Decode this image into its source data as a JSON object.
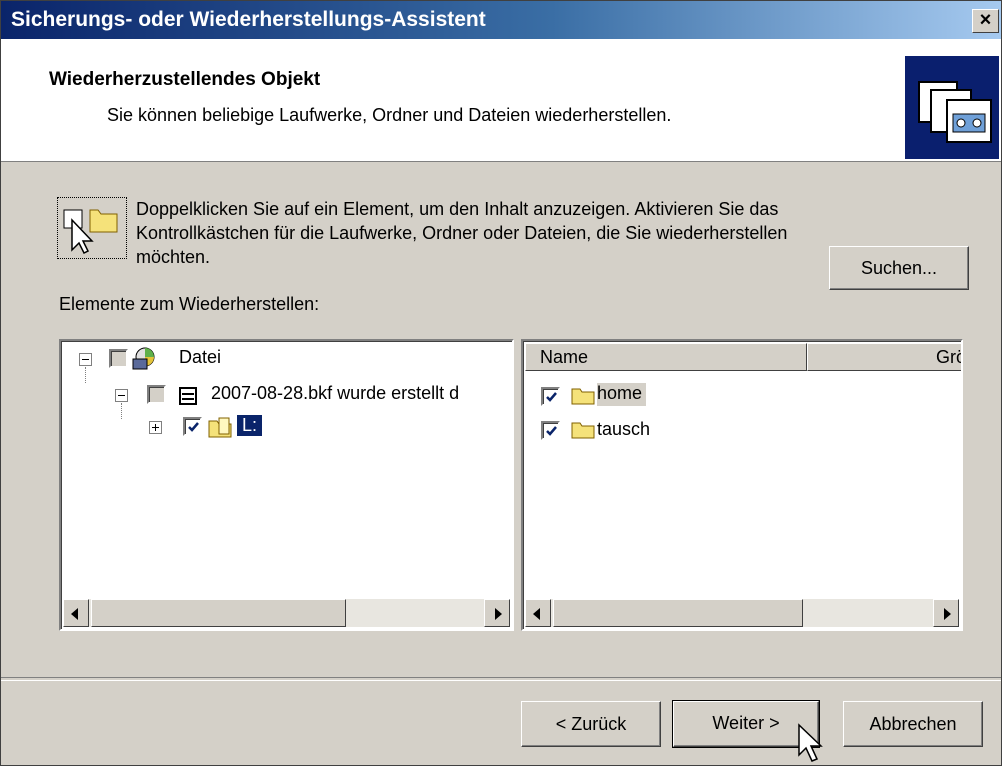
{
  "window": {
    "title": "Sicherungs- oder Wiederherstellungs-Assistent",
    "close_label": "×"
  },
  "header": {
    "heading": "Wiederherzustellendes Objekt",
    "subheading": "Sie können beliebige Laufwerke, Ordner und Dateien wiederherstellen."
  },
  "info": {
    "text": "Doppelklicken Sie auf ein Element, um den Inhalt anzuzeigen. Aktivieren Sie das Kontrollkästchen für die Laufwerke, Ordner oder Dateien, die Sie wiederherstellen möchten."
  },
  "search_button": "Suchen...",
  "items_label": "Elemente zum Wiederherstellen:",
  "tree": {
    "root": "Datei",
    "backup": "2007-08-28.bkf wurde erstellt d",
    "drive": "L:"
  },
  "list": {
    "columns": [
      "Name",
      "Grö"
    ],
    "items": [
      "home",
      "tausch"
    ]
  },
  "buttons": {
    "back": "< Zurück",
    "next": "Weiter >",
    "cancel": "Abbrechen"
  }
}
